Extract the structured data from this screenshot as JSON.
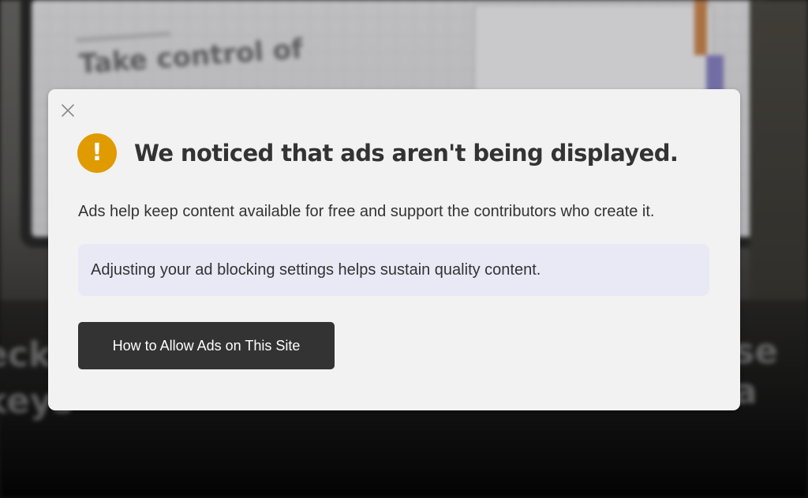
{
  "modal": {
    "close_icon": "close-icon",
    "warning_icon": "exclamation-icon",
    "warning_glyph": "!",
    "title": "We noticed that ads aren't being displayed.",
    "body": "Ads help keep content available for free and support the contributors who create it.",
    "callout": "Adjusting your ad blocking settings helps sustain quality content.",
    "button_label": "How to Allow Ads on This Site"
  },
  "background": {
    "heading": "Take control of",
    "left_text": "eck\nkeys",
    "right_text": "se a"
  },
  "colors": {
    "warning": "#e09b00",
    "modal_bg": "#f2f2f2",
    "callout_bg": "#e9e8f5",
    "button_bg": "#333333",
    "text": "#333333"
  }
}
